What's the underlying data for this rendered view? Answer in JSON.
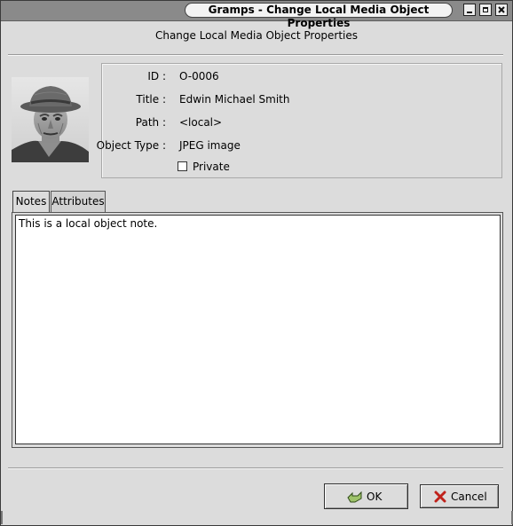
{
  "window": {
    "title": "Gramps - Change Local Media Object Properties",
    "minimize_glyph": "_",
    "maximize_glyph": "□",
    "close_glyph": "×"
  },
  "dialog": {
    "heading": "Change Local Media Object Properties"
  },
  "properties": {
    "id_label": "ID :",
    "id_value": "O-0006",
    "title_label": "Title :",
    "title_value": "Edwin Michael Smith",
    "path_label": "Path :",
    "path_value": "<local>",
    "type_label": "Object Type :",
    "type_value": "JPEG image",
    "private_label": "Private",
    "private_checked": false
  },
  "tabs": [
    {
      "label": "Notes",
      "active": true
    },
    {
      "label": "Attributes",
      "active": false
    }
  ],
  "notes": {
    "text": "This is a local object note."
  },
  "buttons": {
    "ok_label": "OK",
    "ok_icon": "ok-check-icon",
    "cancel_label": "Cancel",
    "cancel_icon": "cancel-x-icon"
  }
}
